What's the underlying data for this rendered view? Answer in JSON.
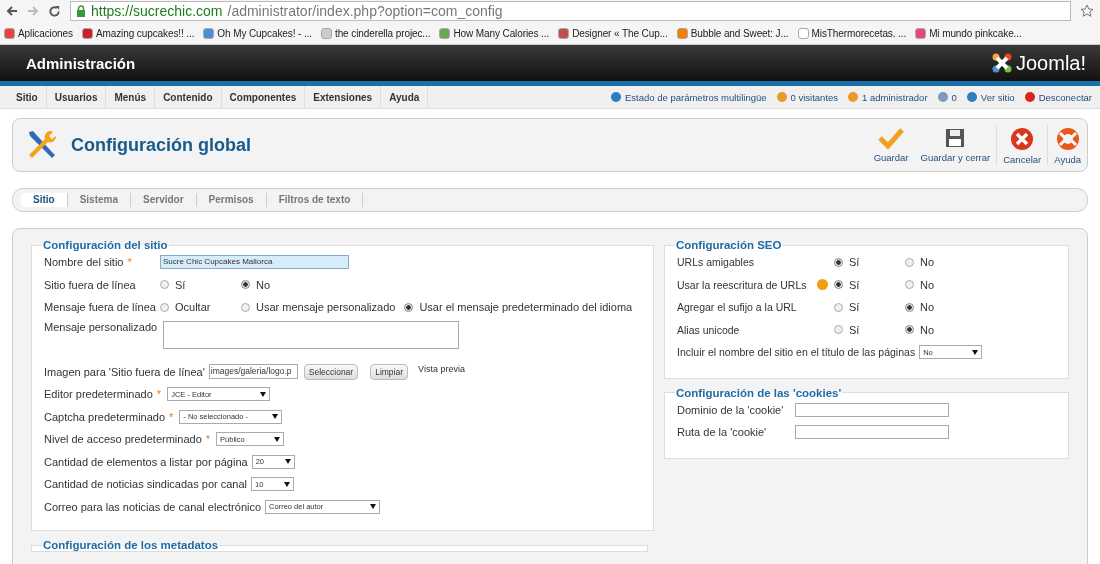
{
  "browser": {
    "url_host": "https://sucrechic.com",
    "url_path": "/administrator/index.php?option=com_config",
    "bookmarks": [
      {
        "label": "Aplicaciones",
        "color": "#e8453c"
      },
      {
        "label": "Amazing cupcakes!! ...",
        "color": "#cb2027"
      },
      {
        "label": "Oh My Cupcakes! - ...",
        "color": "#4a90d9"
      },
      {
        "label": "the cinderella projec...",
        "color": "#cccccc"
      },
      {
        "label": "How Many Calories ...",
        "color": "#6aa84f"
      },
      {
        "label": "Designer « The Cup...",
        "color": "#c0504d"
      },
      {
        "label": "Bubble and Sweet: J...",
        "color": "#f57d00"
      },
      {
        "label": "MisThermorecetas. ...",
        "color": "#ffffff"
      },
      {
        "label": "Mi mundo pinkcake...",
        "color": "#e8457c"
      }
    ]
  },
  "header": {
    "title": "Administración",
    "logo": "Joomla!"
  },
  "menu": {
    "items": [
      "Sitio",
      "Usuarios",
      "Menús",
      "Contenido",
      "Componentes",
      "Extensiones",
      "Ayuda"
    ],
    "status": [
      {
        "label": "Estado de parámetros multilingüe",
        "color": "#2a7fc1"
      },
      {
        "label": "0 visitantes",
        "color": "#e89a2a"
      },
      {
        "label": "1 administrador",
        "color": "#e89a2a"
      },
      {
        "label": "0",
        "color": "#7a9bbf"
      },
      {
        "label": "Ver sitio",
        "color": "#2a7fc1"
      },
      {
        "label": "Desconectar",
        "color": "#d9261c"
      }
    ]
  },
  "toolbar": {
    "title": "Configuración global",
    "buttons": [
      {
        "label": "Guardar",
        "kind": "check"
      },
      {
        "label": "Guardar y cerrar",
        "kind": "disk"
      },
      {
        "label": "Cancelar",
        "kind": "cancel"
      },
      {
        "label": "Ayuda",
        "kind": "help"
      }
    ]
  },
  "tabs": [
    {
      "label": "Sitio",
      "selected": true
    },
    {
      "label": "Sistema",
      "selected": false
    },
    {
      "label": "Servidor",
      "selected": false
    },
    {
      "label": "Permisos",
      "selected": false
    },
    {
      "label": "Filtros de texto",
      "selected": false
    }
  ],
  "site_config": {
    "title": "Configuración del sitio",
    "rows": [
      {
        "kind": "text",
        "label": "Nombre del sitio",
        "marker": "*",
        "value": "Sucre Chic Cupcakes Mallorca"
      },
      {
        "kind": "radio",
        "label": "Sitio fuera de línea",
        "options": [
          {
            "label": "Sí",
            "selected": false
          },
          {
            "label": "No",
            "selected": true
          }
        ]
      },
      {
        "kind": "radio",
        "label": "Mensaje fuera de línea",
        "options": [
          {
            "label": "Ocultar",
            "selected": false
          },
          {
            "label": "Usar mensaje personalizado",
            "selected": false
          },
          {
            "label": "Usar el mensaje predeterminado del idioma",
            "selected": true
          }
        ]
      },
      {
        "kind": "textarea",
        "label": "Mensaje personalizado"
      },
      {
        "kind": "image",
        "label": "Imagen para 'Sitio fuera de línea'",
        "value": "images/galeria/logo.p",
        "buttons": [
          "Seleccionar",
          "Limpiar"
        ],
        "preview": "Vista previa"
      },
      {
        "kind": "select",
        "label": "Editor predeterminado",
        "marker": "*",
        "value": "JCE - Editor"
      },
      {
        "kind": "select",
        "label": "Captcha predeterminado",
        "marker": "*",
        "value": "- No seleccionado -"
      },
      {
        "kind": "select",
        "label": "Nivel de acceso predeterminado",
        "marker": "*",
        "value": "Público"
      },
      {
        "kind": "select",
        "label": "Cantidad de elementos a listar por página",
        "value": "20"
      },
      {
        "kind": "select",
        "label": "Cantidad de noticias sindicadas por canal",
        "value": "10"
      },
      {
        "kind": "select",
        "label": "Correo para las noticias de canal electrónico",
        "value": "Correo del autor"
      }
    ]
  },
  "metadata": {
    "title": "Configuración de los metadatos"
  },
  "seo": {
    "title": "Configuración SEO",
    "rows": [
      {
        "kind": "radio",
        "label": "URLs amigables",
        "warning": false,
        "options": [
          {
            "label": "Sí",
            "selected": true
          },
          {
            "label": "No",
            "selected": false
          }
        ]
      },
      {
        "kind": "radio",
        "label": "Usar la reescritura de URLs",
        "warning": true,
        "options": [
          {
            "label": "Sí",
            "selected": true
          },
          {
            "label": "No",
            "selected": false
          }
        ]
      },
      {
        "kind": "radio",
        "label": "Agregar el sufijo a la URL",
        "warning": false,
        "options": [
          {
            "label": "Sí",
            "selected": false
          },
          {
            "label": "No",
            "selected": true
          }
        ]
      },
      {
        "kind": "radio",
        "label": "Alias unicode",
        "warning": false,
        "options": [
          {
            "label": "Sí",
            "selected": false
          },
          {
            "label": "No",
            "selected": true
          }
        ]
      },
      {
        "kind": "select",
        "label": "Incluir el nombre del sitio en el título de las páginas",
        "value": "No"
      }
    ]
  },
  "cookies": {
    "title": "Configuración de las 'cookies'",
    "rows": [
      {
        "kind": "text",
        "label": "Dominio de la 'cookie'"
      },
      {
        "kind": "text",
        "label": "Ruta de la 'cookie'"
      }
    ]
  }
}
